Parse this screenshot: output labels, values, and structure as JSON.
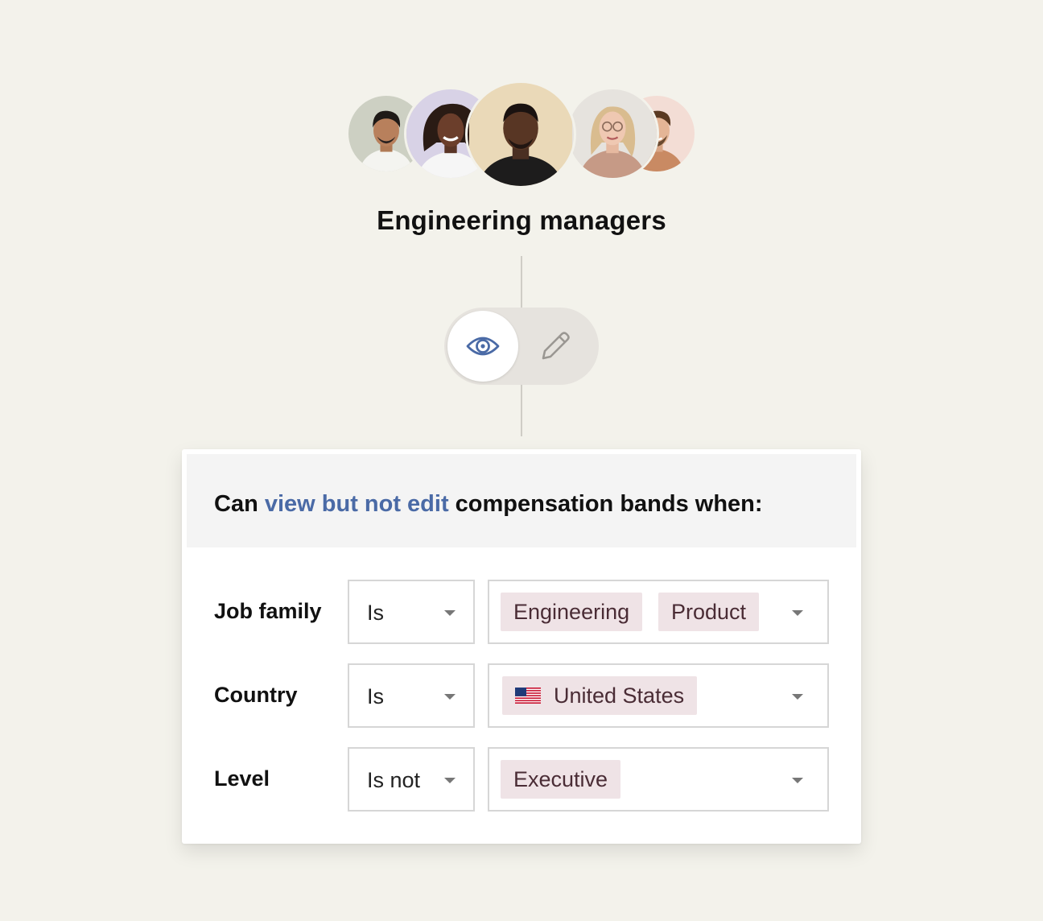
{
  "group": {
    "title": "Engineering managers",
    "avatars": [
      {
        "bg": "#cdd0c3"
      },
      {
        "bg": "#d8d2e6"
      },
      {
        "bg": "#ead9b8"
      },
      {
        "bg": "#e6e3de"
      },
      {
        "bg": "#f3ddd5"
      }
    ]
  },
  "access_toggle": {
    "selected": "view",
    "options": [
      {
        "icon": "eye-icon",
        "mode": "view",
        "color": "#4a6aa6"
      },
      {
        "icon": "pencil-icon",
        "mode": "edit",
        "color": "#9a9792"
      }
    ]
  },
  "rule_card": {
    "title_prefix": "Can ",
    "title_highlight": "view but not edit",
    "title_suffix": " compensation bands when:",
    "highlight_color": "#4a6aa6",
    "conditions": [
      {
        "label": "Job family",
        "operator": "Is",
        "values": [
          "Engineering",
          "Product"
        ]
      },
      {
        "label": "Country",
        "operator": "Is",
        "values": [
          "United States"
        ],
        "value_icon": "us-flag-icon"
      },
      {
        "label": "Level",
        "operator": "Is not",
        "values": [
          "Executive"
        ]
      }
    ],
    "chip_color": "#efe3e6"
  }
}
